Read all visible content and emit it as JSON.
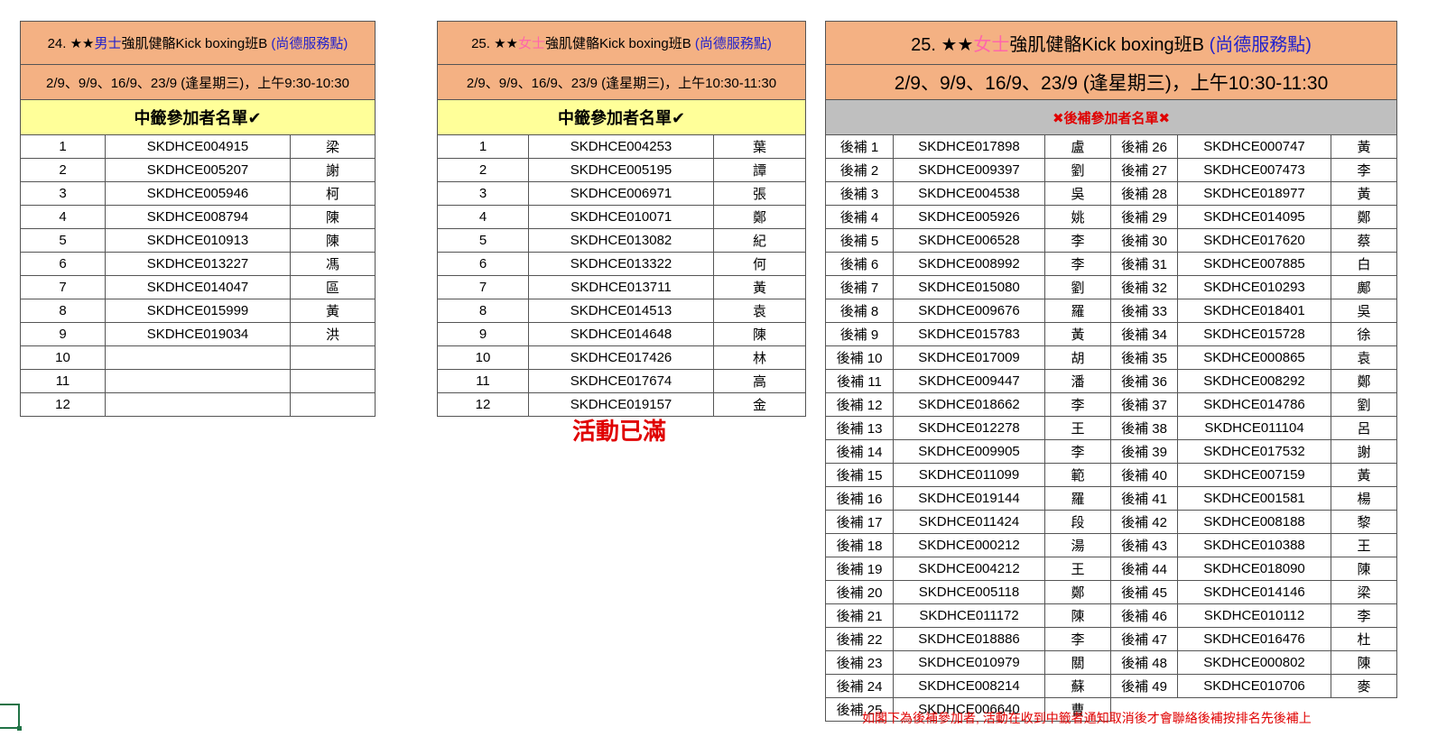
{
  "table1": {
    "title_prefix": "24. ★★",
    "title_gender": "男士",
    "title_main": "強肌健骼Kick boxing班B",
    "title_location": "(尚德服務點)",
    "schedule": "2/9、9/9、16/9、23/9 (逢星期三)，上午9:30-10:30",
    "list_title": "中籤參加者名單",
    "check_mark": "✔",
    "rows": [
      {
        "no": "1",
        "code": "SKDHCE004915",
        "name": "梁"
      },
      {
        "no": "2",
        "code": "SKDHCE005207",
        "name": "謝"
      },
      {
        "no": "3",
        "code": "SKDHCE005946",
        "name": "柯"
      },
      {
        "no": "4",
        "code": "SKDHCE008794",
        "name": "陳"
      },
      {
        "no": "5",
        "code": "SKDHCE010913",
        "name": "陳"
      },
      {
        "no": "6",
        "code": "SKDHCE013227",
        "name": "馮"
      },
      {
        "no": "7",
        "code": "SKDHCE014047",
        "name": "區"
      },
      {
        "no": "8",
        "code": "SKDHCE015999",
        "name": "黃"
      },
      {
        "no": "9",
        "code": "SKDHCE019034",
        "name": "洪"
      },
      {
        "no": "10",
        "code": "",
        "name": ""
      },
      {
        "no": "11",
        "code": "",
        "name": ""
      },
      {
        "no": "12",
        "code": "",
        "name": ""
      }
    ]
  },
  "table2": {
    "title_prefix": "25. ★★",
    "title_gender": "女士",
    "title_main": "強肌健骼Kick boxing班B",
    "title_location": "(尚德服務點)",
    "schedule": "2/9、9/9、16/9、23/9 (逢星期三)，上午10:30-11:30",
    "list_title": "中籤參加者名單",
    "check_mark": "✔",
    "full_note": "活動已滿",
    "rows": [
      {
        "no": "1",
        "code": "SKDHCE004253",
        "name": "葉"
      },
      {
        "no": "2",
        "code": "SKDHCE005195",
        "name": "譚"
      },
      {
        "no": "3",
        "code": "SKDHCE006971",
        "name": "張"
      },
      {
        "no": "4",
        "code": "SKDHCE010071",
        "name": "鄭"
      },
      {
        "no": "5",
        "code": "SKDHCE013082",
        "name": "紀"
      },
      {
        "no": "6",
        "code": "SKDHCE013322",
        "name": "何"
      },
      {
        "no": "7",
        "code": "SKDHCE013711",
        "name": "黃"
      },
      {
        "no": "8",
        "code": "SKDHCE014513",
        "name": "袁"
      },
      {
        "no": "9",
        "code": "SKDHCE014648",
        "name": "陳"
      },
      {
        "no": "10",
        "code": "SKDHCE017426",
        "name": "林"
      },
      {
        "no": "11",
        "code": "SKDHCE017674",
        "name": "高"
      },
      {
        "no": "12",
        "code": "SKDHCE019157",
        "name": "金"
      }
    ]
  },
  "table3": {
    "title_prefix": "25. ★★",
    "title_gender": "女士",
    "title_main": "強肌健骼Kick boxing班B",
    "title_location": "(尚德服務點)",
    "schedule": "2/9、9/9、16/9、23/9 (逢星期三)，上午10:30-11:30",
    "list_title": "後補參加者名單",
    "cross_mark": "✖",
    "footnote": "如閣下為後補參加者, 活動在收到中籤者通知取消後才會聯絡後補按排名先後補上",
    "rows": [
      {
        "l_no": "後補 1",
        "l_code": "SKDHCE017898",
        "l_name": "盧",
        "r_no": "後補 26",
        "r_code": "SKDHCE000747",
        "r_name": "黃"
      },
      {
        "l_no": "後補 2",
        "l_code": "SKDHCE009397",
        "l_name": "劉",
        "r_no": "後補 27",
        "r_code": "SKDHCE007473",
        "r_name": "李"
      },
      {
        "l_no": "後補 3",
        "l_code": "SKDHCE004538",
        "l_name": "吳",
        "r_no": "後補 28",
        "r_code": "SKDHCE018977",
        "r_name": "黃"
      },
      {
        "l_no": "後補 4",
        "l_code": "SKDHCE005926",
        "l_name": "姚",
        "r_no": "後補 29",
        "r_code": "SKDHCE014095",
        "r_name": "鄭"
      },
      {
        "l_no": "後補 5",
        "l_code": "SKDHCE006528",
        "l_name": "李",
        "r_no": "後補 30",
        "r_code": "SKDHCE017620",
        "r_name": "蔡"
      },
      {
        "l_no": "後補 6",
        "l_code": "SKDHCE008992",
        "l_name": "李",
        "r_no": "後補 31",
        "r_code": "SKDHCE007885",
        "r_name": "白"
      },
      {
        "l_no": "後補 7",
        "l_code": "SKDHCE015080",
        "l_name": "劉",
        "r_no": "後補 32",
        "r_code": "SKDHCE010293",
        "r_name": "鄺"
      },
      {
        "l_no": "後補 8",
        "l_code": "SKDHCE009676",
        "l_name": "羅",
        "r_no": "後補 33",
        "r_code": "SKDHCE018401",
        "r_name": "吳"
      },
      {
        "l_no": "後補 9",
        "l_code": "SKDHCE015783",
        "l_name": "黃",
        "r_no": "後補 34",
        "r_code": "SKDHCE015728",
        "r_name": "徐"
      },
      {
        "l_no": "後補 10",
        "l_code": "SKDHCE017009",
        "l_name": "胡",
        "r_no": "後補 35",
        "r_code": "SKDHCE000865",
        "r_name": "袁"
      },
      {
        "l_no": "後補 11",
        "l_code": "SKDHCE009447",
        "l_name": "潘",
        "r_no": "後補 36",
        "r_code": "SKDHCE008292",
        "r_name": "鄭"
      },
      {
        "l_no": "後補 12",
        "l_code": "SKDHCE018662",
        "l_name": "李",
        "r_no": "後補 37",
        "r_code": "SKDHCE014786",
        "r_name": "劉"
      },
      {
        "l_no": "後補 13",
        "l_code": "SKDHCE012278",
        "l_name": "王",
        "r_no": "後補 38",
        "r_code": "SKDHCE011104",
        "r_name": "呂"
      },
      {
        "l_no": "後補 14",
        "l_code": "SKDHCE009905",
        "l_name": "李",
        "r_no": "後補 39",
        "r_code": "SKDHCE017532",
        "r_name": "謝"
      },
      {
        "l_no": "後補 15",
        "l_code": "SKDHCE011099",
        "l_name": "範",
        "r_no": "後補 40",
        "r_code": "SKDHCE007159",
        "r_name": "黃"
      },
      {
        "l_no": "後補 16",
        "l_code": "SKDHCE019144",
        "l_name": "羅",
        "r_no": "後補 41",
        "r_code": "SKDHCE001581",
        "r_name": "楊"
      },
      {
        "l_no": "後補 17",
        "l_code": "SKDHCE011424",
        "l_name": "段",
        "r_no": "後補 42",
        "r_code": "SKDHCE008188",
        "r_name": "黎"
      },
      {
        "l_no": "後補 18",
        "l_code": "SKDHCE000212",
        "l_name": "湯",
        "r_no": "後補 43",
        "r_code": "SKDHCE010388",
        "r_name": "王"
      },
      {
        "l_no": "後補 19",
        "l_code": "SKDHCE004212",
        "l_name": "王",
        "r_no": "後補 44",
        "r_code": "SKDHCE018090",
        "r_name": "陳"
      },
      {
        "l_no": "後補 20",
        "l_code": "SKDHCE005118",
        "l_name": "鄭",
        "r_no": "後補 45",
        "r_code": "SKDHCE014146",
        "r_name": "梁"
      },
      {
        "l_no": "後補 21",
        "l_code": "SKDHCE011172",
        "l_name": "陳",
        "r_no": "後補 46",
        "r_code": "SKDHCE010112",
        "r_name": "李"
      },
      {
        "l_no": "後補 22",
        "l_code": "SKDHCE018886",
        "l_name": "李",
        "r_no": "後補 47",
        "r_code": "SKDHCE016476",
        "r_name": "杜"
      },
      {
        "l_no": "後補 23",
        "l_code": "SKDHCE010979",
        "l_name": "關",
        "r_no": "後補 48",
        "r_code": "SKDHCE000802",
        "r_name": "陳"
      },
      {
        "l_no": "後補 24",
        "l_code": "SKDHCE008214",
        "l_name": "蘇",
        "r_no": "後補 49",
        "r_code": "SKDHCE010706",
        "r_name": "麥"
      },
      {
        "l_no": "後補 25",
        "l_code": "SKDHCE006640",
        "l_name": "曹",
        "r_no": "",
        "r_code": "",
        "r_name": ""
      }
    ]
  }
}
